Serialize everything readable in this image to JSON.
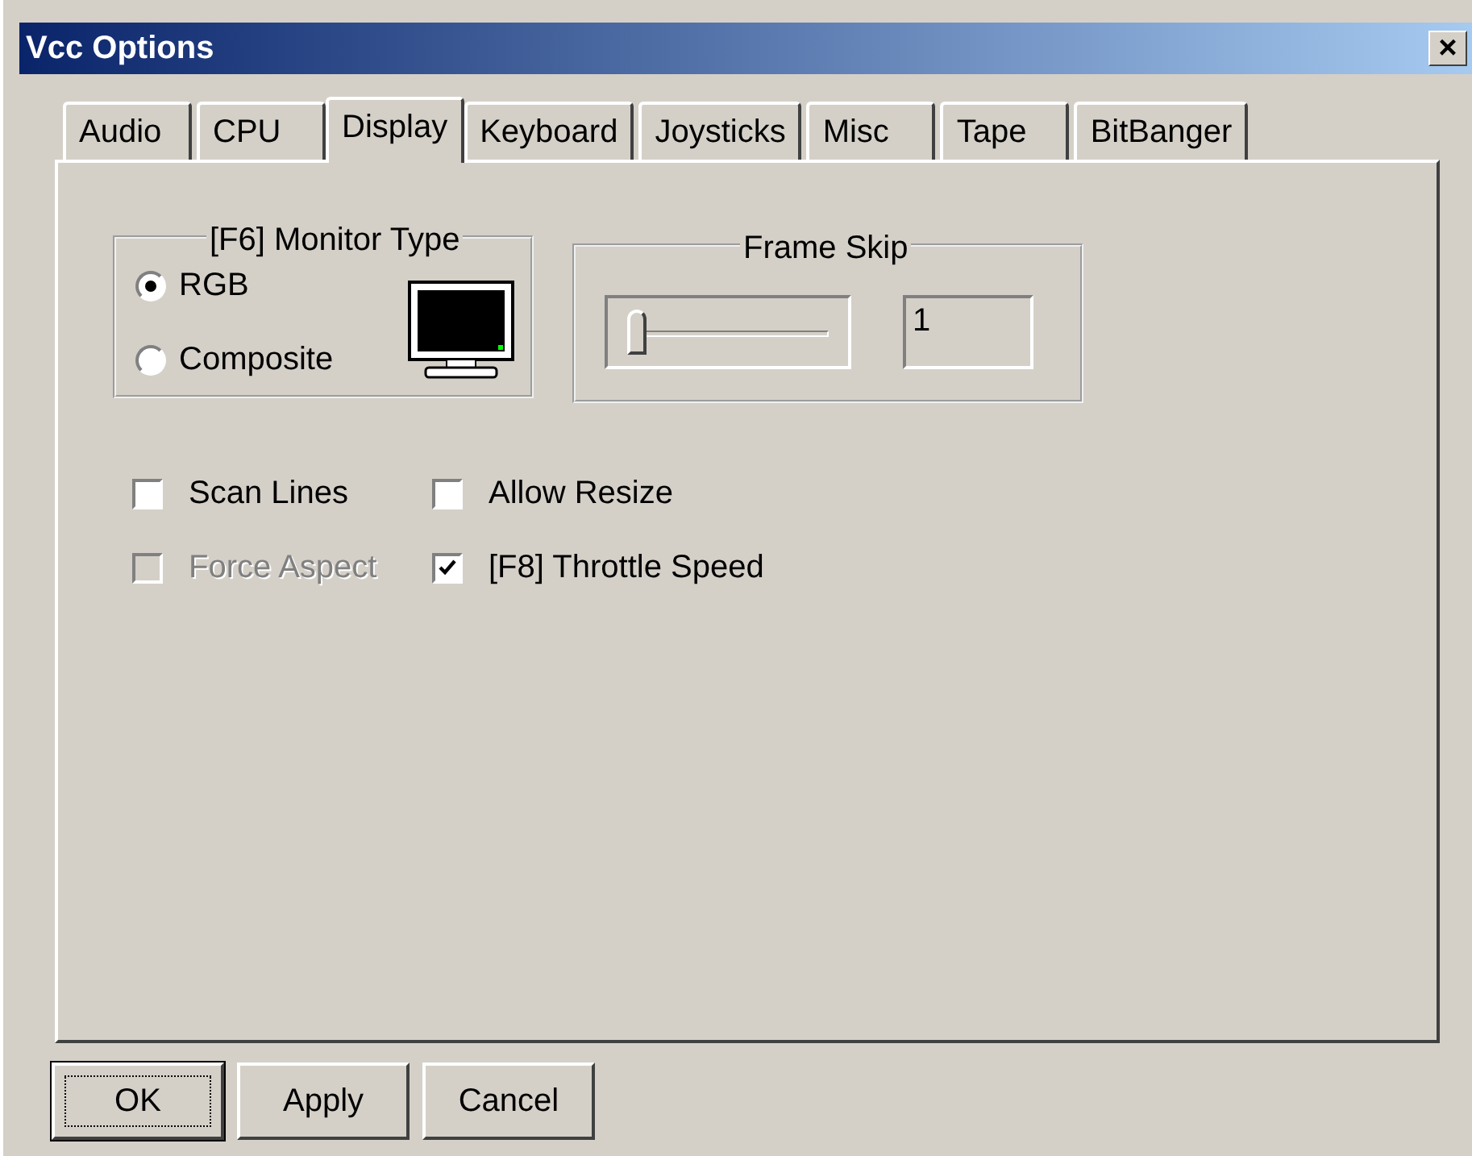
{
  "window": {
    "title": "Vcc Options",
    "close": "×"
  },
  "tabs": [
    {
      "label": "Audio",
      "selected": false
    },
    {
      "label": "CPU",
      "selected": false
    },
    {
      "label": "Display",
      "selected": true
    },
    {
      "label": "Keyboard",
      "selected": false
    },
    {
      "label": "Joysticks",
      "selected": false
    },
    {
      "label": "Misc",
      "selected": false
    },
    {
      "label": "Tape",
      "selected": false
    },
    {
      "label": "BitBanger",
      "selected": false
    }
  ],
  "monitor_type": {
    "title": "[F6] Monitor Type",
    "options": [
      {
        "label": "RGB",
        "selected": true
      },
      {
        "label": "Composite",
        "selected": false
      }
    ]
  },
  "frame_skip": {
    "title": "Frame Skip",
    "level": 0,
    "value": "1"
  },
  "checkboxes": [
    {
      "label": "Scan Lines",
      "checked": false,
      "disabled": false
    },
    {
      "label": "Allow Resize",
      "checked": false,
      "disabled": false
    },
    {
      "label": "Force Aspect",
      "checked": false,
      "disabled": true
    },
    {
      "label": "[F8] Throttle Speed",
      "checked": true,
      "disabled": false
    }
  ],
  "buttons": [
    {
      "label": "OK",
      "default": true
    },
    {
      "label": "Apply",
      "default": false
    },
    {
      "label": "Cancel",
      "default": false
    }
  ]
}
